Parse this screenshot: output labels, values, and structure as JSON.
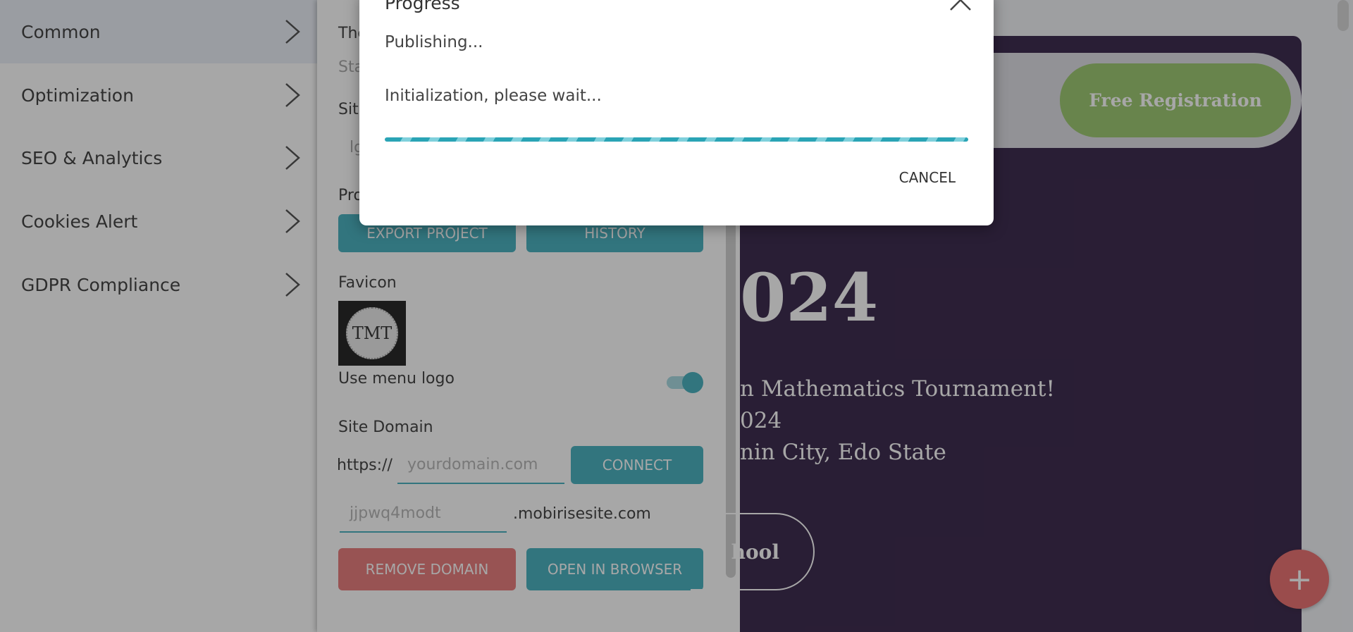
{
  "sidebar": {
    "items": [
      {
        "label": "Common"
      },
      {
        "label": "Optimization"
      },
      {
        "label": "SEO & Analytics"
      },
      {
        "label": "Cookies Alert"
      },
      {
        "label": "GDPR Compliance"
      }
    ]
  },
  "settings": {
    "cut_labels": [
      "The",
      "Sta",
      "Site",
      "lg",
      "Pro"
    ],
    "export_label": "EXPORT PROJECT",
    "history_label": "HISTORY",
    "favicon_label": "Favicon",
    "favicon_text": "TMT",
    "use_menu_logo_label": "Use menu logo",
    "use_menu_logo_on": true,
    "site_domain_label": "Site Domain",
    "protocol": "https://",
    "domain_placeholder": "yourdomain.com",
    "connect_label": "CONNECT",
    "subdomain_value": "jjpwq4modt",
    "subdomain_suffix": ".mobirisesite.com",
    "remove_domain_label": "REMOVE DOMAIN",
    "open_browser_label": "OPEN IN BROWSER"
  },
  "preview": {
    "register_label": "Free Registration",
    "year_partial": "024",
    "line1": "n Mathematics Tournament!",
    "line2": "024",
    "line3": "nin City, Edo State",
    "school_label": "hool",
    "fab_label": "+"
  },
  "dialog": {
    "title": "Progress",
    "status": "Publishing...",
    "message": "Initialization, please wait...",
    "cancel_label": "CANCEL"
  },
  "colors": {
    "accent": "#2aa4b5",
    "danger": "#e36666",
    "hero_bg": "#1b0630",
    "register_bg": "#8cbf59"
  }
}
